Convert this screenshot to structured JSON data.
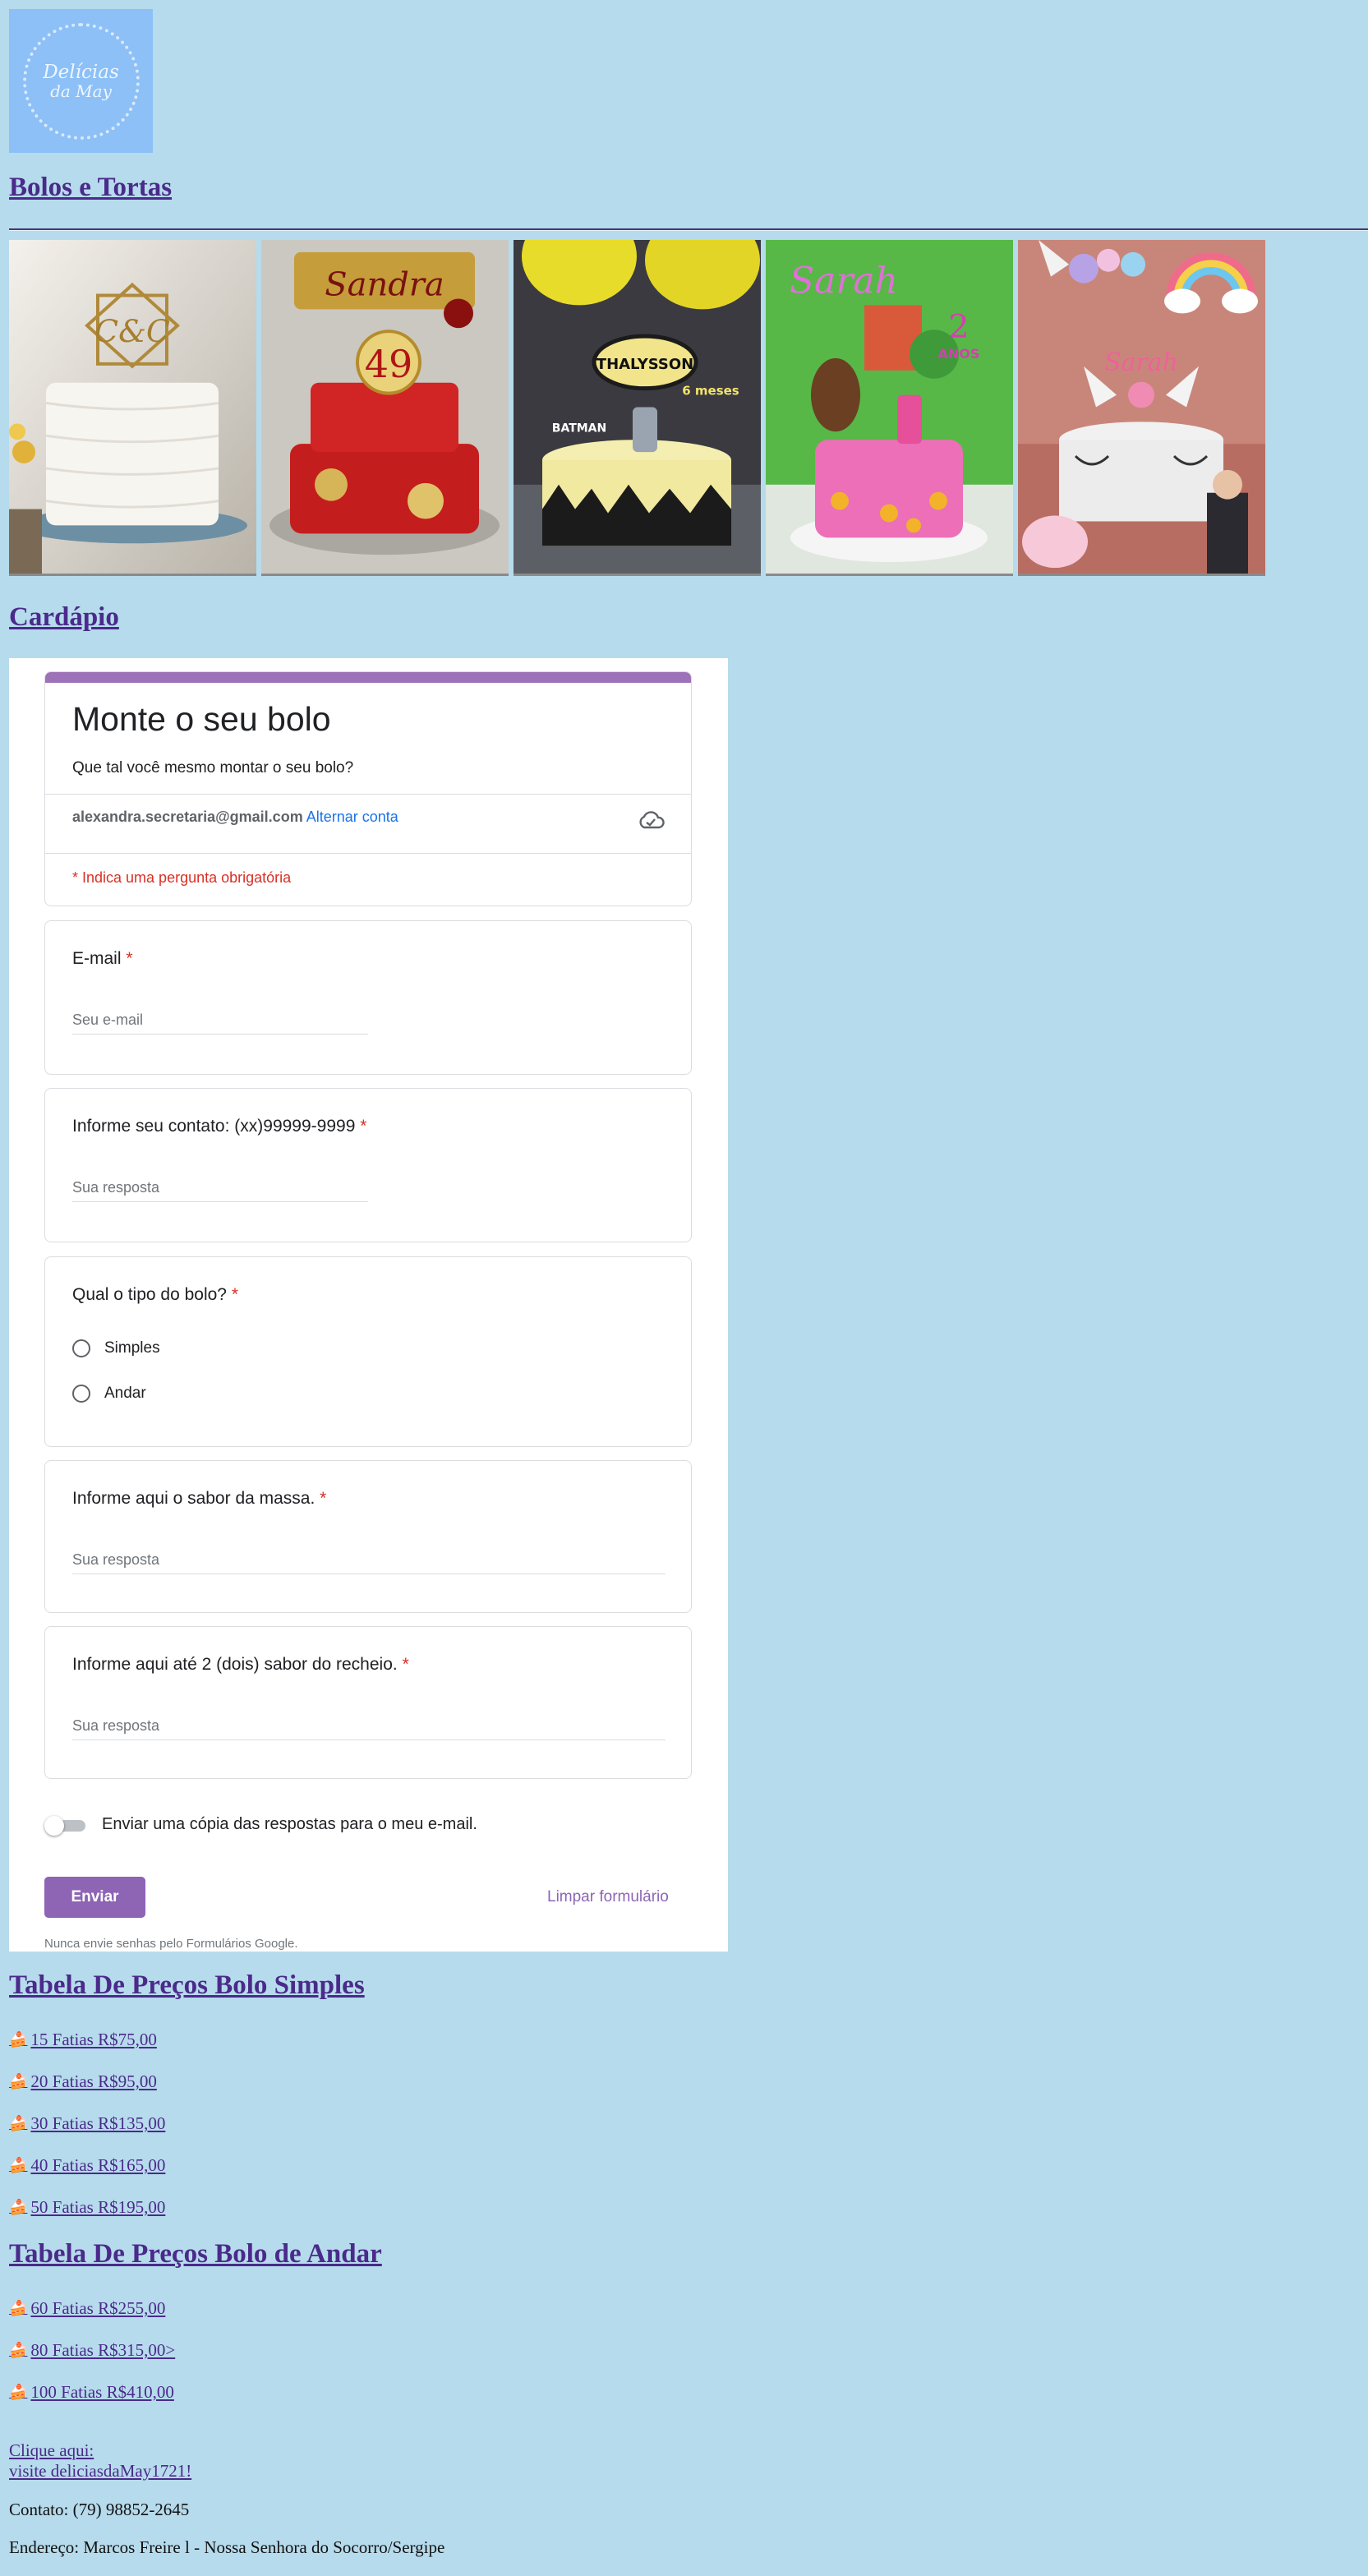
{
  "logo": {
    "line1": "Delícias",
    "line2": "da May"
  },
  "section_bolos": "Bolos e Tortas",
  "section_cardapio": "Cardápio",
  "gallery": {
    "cakes": [
      {
        "topper": "C&C"
      },
      {
        "topper1": "Sandra",
        "topper2": "49"
      },
      {
        "topper1": "THALYSSON",
        "topper2": "6 meses",
        "topper3": "BATMAN"
      },
      {
        "topper1": "Sarah",
        "topper2": "2",
        "topper3": "ANOS"
      },
      {
        "topper": "Sarah"
      }
    ]
  },
  "form": {
    "title": "Monte o seu bolo",
    "description": "Que tal você mesmo montar o seu bolo?",
    "account_email": "alexandra.secretaria@gmail.com",
    "switch_account": "Alternar conta",
    "required_note": "* Indica uma pergunta obrigatória",
    "required_star": "*",
    "questions": [
      {
        "label": "E-mail",
        "placeholder": "Seu e-mail"
      },
      {
        "label": "Informe seu contato: (xx)99999-9999",
        "placeholder": "Sua resposta"
      },
      {
        "label": "Qual o tipo do bolo?",
        "options": [
          "Simples",
          "Andar"
        ]
      },
      {
        "label": "Informe aqui o sabor da massa.",
        "placeholder": "Sua resposta"
      },
      {
        "label": "Informe aqui até 2 (dois) sabor do recheio.",
        "placeholder": "Sua resposta"
      }
    ],
    "copy_toggle": "Enviar uma cópia das respostas para o meu e-mail.",
    "submit": "Enviar",
    "clear": "Limpar formulário",
    "never_passwords": "Nunca envie senhas pelo Formulários Google."
  },
  "prices_simple": {
    "title": "Tabela De Preços Bolo Simples",
    "icon": "cake-icon",
    "items": [
      "15 Fatias R$75,00",
      "20 Fatias R$95,00",
      "30 Fatias R$135,00",
      "40 Fatias R$165,00",
      "50 Fatias R$195,00"
    ]
  },
  "prices_tier": {
    "title": "Tabela De Preços Bolo de Andar",
    "items": [
      "60 Fatias R$255,00",
      "80 Fatias R$315,00>",
      "100 Fatias R$410,00"
    ]
  },
  "footer": {
    "click_here": "Clique aqui:",
    "visit": "visite deliciasdaMay1721!",
    "contact": "Contato: (79) 98852-2645",
    "address": "Endereço: Marcos Freire l - Nossa Senhora do Socorro/Sergipe"
  },
  "colors": {
    "background": "#b6dbec",
    "form_accent": "#9e72b8",
    "link": "#4a2a8a",
    "required": "#d93025"
  }
}
